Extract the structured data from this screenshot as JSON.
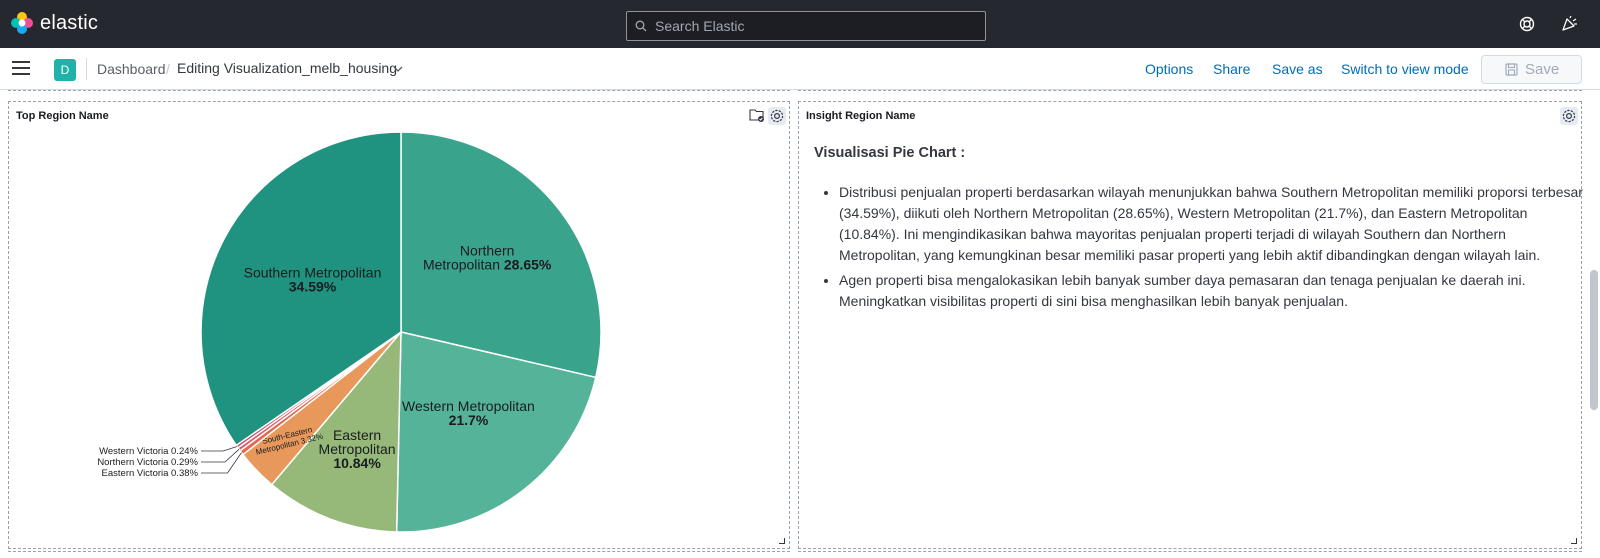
{
  "header": {
    "brand": "elastic",
    "search_placeholder": "Search Elastic",
    "help_icon": "help-icon",
    "news_icon": "newsfeed-icon"
  },
  "subnav": {
    "space_badge": "D",
    "breadcrumb": [
      "Dashboard",
      "Editing Visualization_melb_housing"
    ],
    "links": [
      "Options",
      "Share",
      "Save as",
      "Switch to view mode"
    ],
    "save_label": "Save"
  },
  "panels": {
    "left_title": "Top Region Name",
    "right_title": "Insight Region Name"
  },
  "insight": {
    "heading": "Visualisasi Pie Chart :",
    "bullets": [
      "Distribusi penjualan properti berdasarkan wilayah menunjukkan bahwa Southern Metropolitan memiliki proporsi terbesar (34.59%), diikuti oleh Northern Metropolitan (28.65%), Western Metropolitan (21.7%), dan Eastern Metropolitan (10.84%). Ini mengindikasikan bahwa mayoritas penjualan properti terjadi di wilayah Southern dan Northern Metropolitan, yang kemungkinan besar memiliki pasar properti yang lebih aktif dibandingkan dengan wilayah lain.",
      "Agen properti bisa mengalokasikan lebih banyak sumber daya pemasaran dan tenaga penjualan ke daerah ini. Meningkatkan visibilitas properti di sini bisa menghasilkan lebih banyak penjualan."
    ]
  },
  "colors": {
    "topbar": "#25282f",
    "link": "#006bb8",
    "space_badge": "#20b2aa"
  },
  "chart_data": {
    "type": "pie",
    "title": "",
    "slices": [
      {
        "label": "Northern Metropolitan",
        "pct": "28.65%",
        "value": 28.65,
        "color": "#3aa38b"
      },
      {
        "label": "Western Metropolitan",
        "pct": "21.7%",
        "value": 21.7,
        "color": "#54b399"
      },
      {
        "label": "Eastern Metropolitan",
        "pct": "10.84%",
        "value": 10.84,
        "color": "#96b97a"
      },
      {
        "label": "South-Eastern Metropolitan",
        "pct": "3.32%",
        "value": 3.32,
        "color": "#e7985a"
      },
      {
        "label": "Eastern Victoria",
        "pct": "0.38%",
        "value": 0.38,
        "color": "#e7664c"
      },
      {
        "label": "Northern Victoria",
        "pct": "0.29%",
        "value": 0.29,
        "color": "#d95b6b"
      },
      {
        "label": "Western Victoria",
        "pct": "0.24%",
        "value": 0.24,
        "color": "#c84560"
      },
      {
        "label": "Southern Metropolitan",
        "pct": "34.59%",
        "value": 34.59,
        "color": "#209280"
      }
    ]
  }
}
